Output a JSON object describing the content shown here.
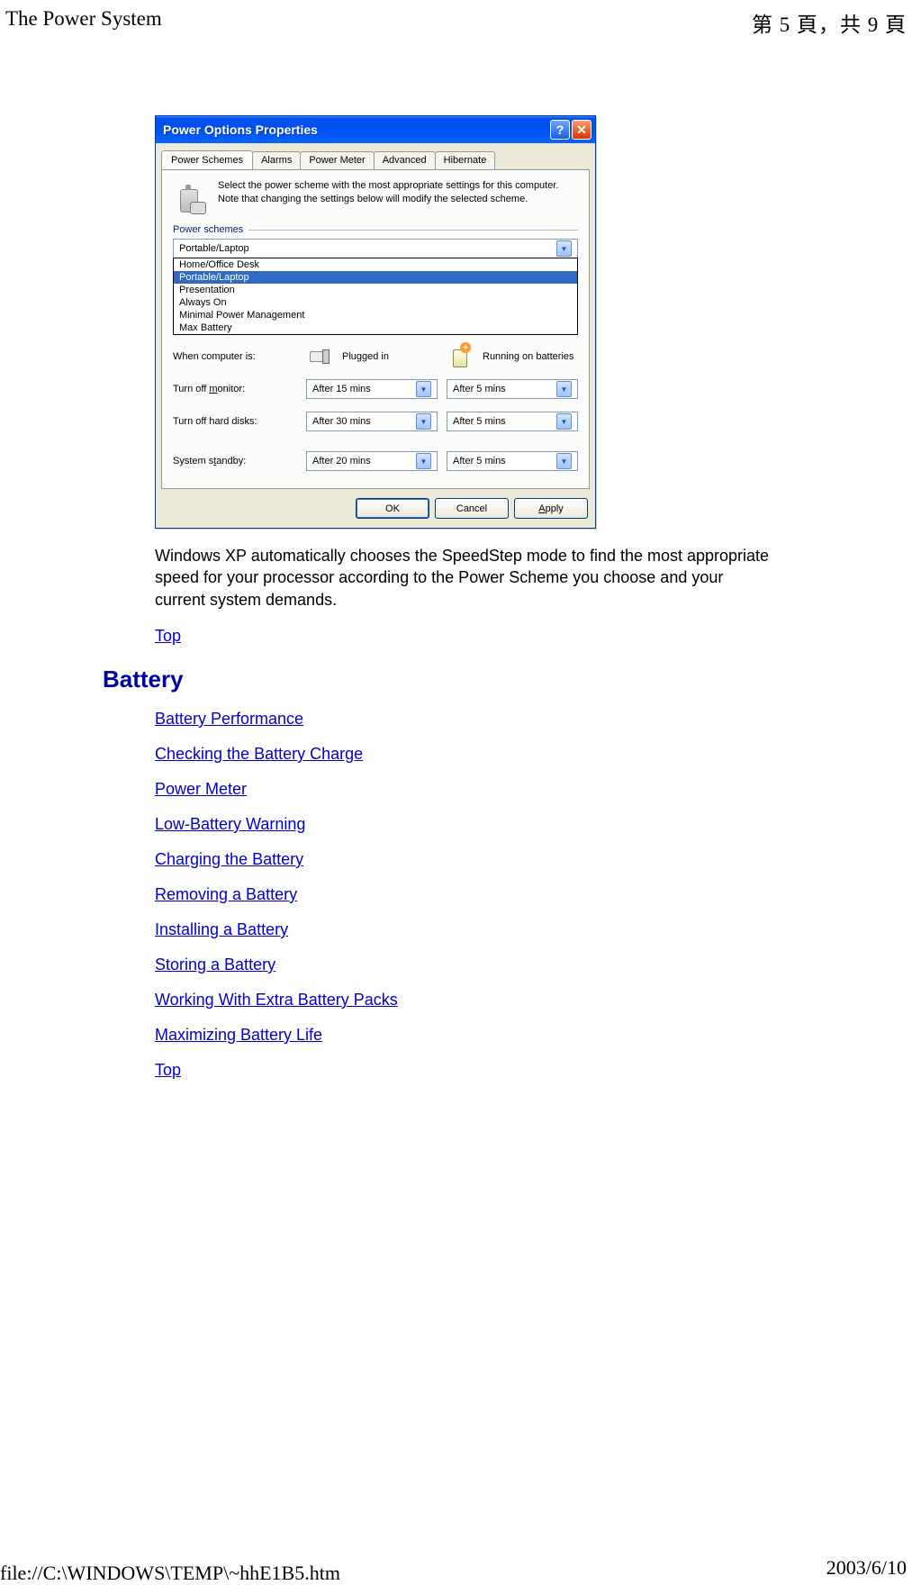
{
  "header": {
    "left": "The Power System",
    "right": "第 5 頁，共 9 頁"
  },
  "dialog": {
    "title": "Power Options Properties",
    "tabs": [
      "Power Schemes",
      "Alarms",
      "Power Meter",
      "Advanced",
      "Hibernate"
    ],
    "info": "Select the power scheme with the most appropriate settings for this computer. Note that changing the settings below will modify the selected scheme.",
    "group_label": "Power schemes",
    "combo_value": "Portable/Laptop",
    "combo_options": [
      "Home/Office Desk",
      "Portable/Laptop",
      "Presentation",
      "Always On",
      "Minimal Power Management",
      "Max Battery"
    ],
    "when_label": "When computer is:",
    "plugged_label": "Plugged in",
    "battery_label": "Running on batteries",
    "rows": {
      "monitor": {
        "label": "Turn off monitor:",
        "plugged": "After 15 mins",
        "battery": "After 5 mins"
      },
      "disks": {
        "label": "Turn off hard disks:",
        "plugged": "After 30 mins",
        "battery": "After 5 mins"
      },
      "standby": {
        "label": "System standby:",
        "plugged": "After 20 mins",
        "battery": "After 5 mins"
      }
    },
    "buttons": {
      "ok": "OK",
      "cancel": "Cancel",
      "apply": "Apply"
    }
  },
  "paragraph": "Windows XP automatically chooses the SpeedStep mode to find the most appropriate speed for your processor according to the Power Scheme you choose and your current system demands.",
  "top_link": "Top",
  "section_heading": "Battery",
  "links": [
    "Battery Performance",
    "Checking the Battery Charge",
    "Power Meter",
    "Low-Battery Warning",
    "Charging the Battery",
    "Removing a Battery",
    "Installing a Battery",
    "Storing a Battery",
    "Working With Extra Battery Packs",
    "Maximizing Battery Life",
    "Top"
  ],
  "footer": {
    "left": "file://C:\\WINDOWS\\TEMP\\~hhE1B5.htm",
    "right": "2003/6/10"
  }
}
